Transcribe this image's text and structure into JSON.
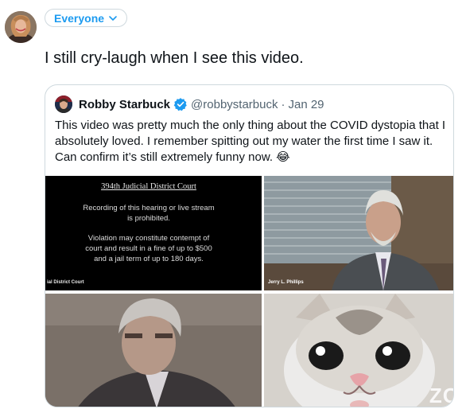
{
  "composer": {
    "audience_label": "Everyone",
    "text": "I still cry-laugh when I see this video."
  },
  "quoted_tweet": {
    "author_name": "Robby Starbuck",
    "handle": "@robbystarbuck",
    "separator": "·",
    "date": "Jan 29",
    "text": "This video was pretty much the only thing about the COVID dystopia that I absolutely loved. I remember spitting out my water the first time I saw it. Can confirm it’s still extremely funny now. 😂",
    "verified_color": "#1d9bf0"
  },
  "media": {
    "court_title": "394th Judicial District Court",
    "court_notice_1": "Recording of this hearing or live stream\nis prohibited.",
    "court_notice_2": "Violation may constitute contempt of\ncourt and result in a fine of up to $500\nand a jail term of up to 180 days.",
    "court_caption": "ial District Court",
    "judge_caption": "Jerry L. Phillips",
    "zoom_watermark": "ZO"
  },
  "colors": {
    "accent": "#1d9bf0",
    "border": "#cfd9de",
    "secondary_text": "#536471"
  }
}
